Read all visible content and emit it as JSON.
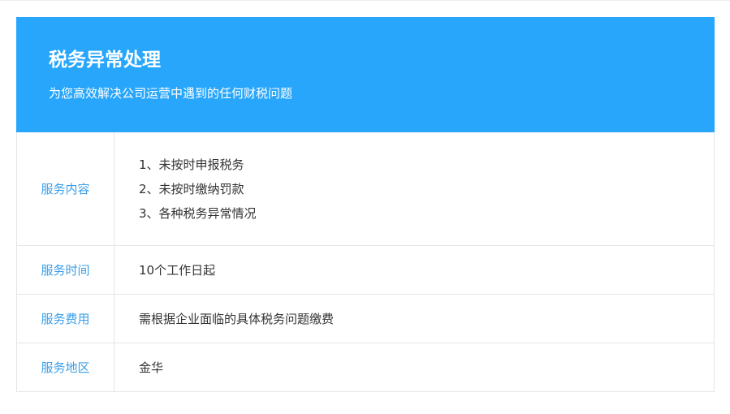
{
  "banner": {
    "title": "税务异常处理",
    "subtitle": "为您高效解决公司运营中遇到的任何财税问题",
    "background_color": "#27a6fc"
  },
  "details": {
    "content": {
      "label": "服务内容",
      "items": [
        "1、未按时申报税务",
        "2、未按时缴纳罚款",
        "3、各种税务异常情况"
      ]
    },
    "time": {
      "label": "服务时间",
      "value": "10个工作日起"
    },
    "fee": {
      "label": "服务费用",
      "value": "需根据企业面临的具体税务问题缴费"
    },
    "region": {
      "label": "服务地区",
      "value": "金华"
    }
  },
  "colors": {
    "label_text": "#3a9ee8",
    "body_text": "#333333",
    "border": "#e5e5e5"
  }
}
